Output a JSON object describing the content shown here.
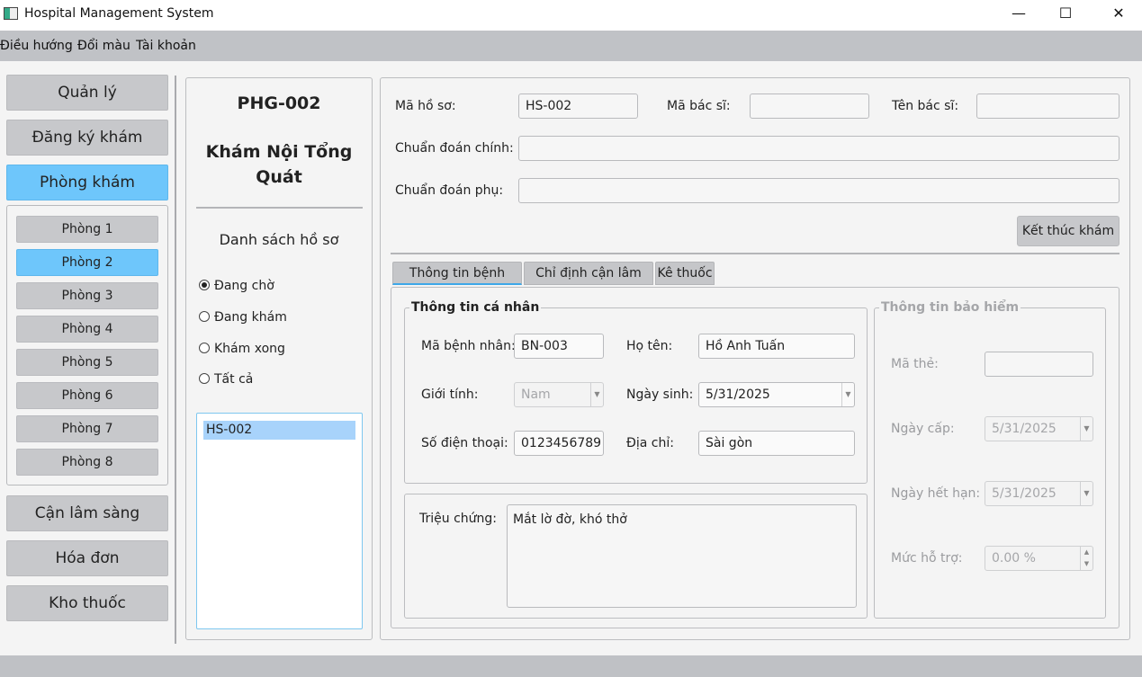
{
  "window": {
    "title": "Hospital Management System",
    "minimize": "—",
    "maximize": "☐",
    "close": "✕"
  },
  "menu": [
    "Điều hướng",
    "Đổi màu",
    "Tài khoản"
  ],
  "nav": {
    "top": [
      "Quản lý",
      "Đăng ký khám",
      "Phòng khám"
    ],
    "active": "Phòng khám",
    "rooms": [
      "Phòng 1",
      "Phòng 2",
      "Phòng 3",
      "Phòng 4",
      "Phòng 5",
      "Phòng 6",
      "Phòng 7",
      "Phòng 8"
    ],
    "active_room": "Phòng 2",
    "bottom": [
      "Cận lâm sàng",
      "Hóa đơn",
      "Kho thuốc"
    ]
  },
  "room": {
    "code": "PHG-002",
    "name": "Khám Nội Tổng Quát",
    "list_title": "Danh sách hồ sơ",
    "filters": [
      "Đang chờ",
      "Đang khám",
      "Khám xong",
      "Tất cả"
    ],
    "selected_filter": "Đang chờ",
    "records": [
      "HS-002"
    ]
  },
  "record": {
    "ma_ho_so_label": "Mã hồ sơ:",
    "ma_ho_so": "HS-002",
    "ma_bac_si_label": "Mã bác sĩ:",
    "ma_bac_si": "",
    "ten_bac_si_label": "Tên bác sĩ:",
    "ten_bac_si": "",
    "chan_doan_chinh_label": "Chuẩn đoán chính:",
    "chan_doan_chinh": "",
    "chan_doan_phu_label": "Chuẩn đoán phụ:",
    "chan_doan_phu": "",
    "finish_button": "Kết thúc khám"
  },
  "tabs": [
    "Thông tin bệnh nhân",
    "Chỉ định cận lâm sàn",
    "Kê thuốc"
  ],
  "active_tab": "Thông tin bệnh nhân",
  "personal": {
    "title": "Thông tin cá nhân",
    "ma_benh_nhan_label": "Mã bệnh nhân:",
    "ma_benh_nhan": "BN-003",
    "ho_ten_label": "Họ tên:",
    "ho_ten": "Hồ Anh Tuấn",
    "gioi_tinh_label": "Giới tính:",
    "gioi_tinh": "Nam",
    "ngay_sinh_label": "Ngày sinh:",
    "ngay_sinh": "5/31/2025",
    "sdt_label": "Số điện thoại:",
    "sdt": "0123456789",
    "dia_chi_label": "Địa chỉ:",
    "dia_chi": "Sài gòn"
  },
  "symptoms": {
    "label": "Triệu chứng:",
    "value": "Mắt lờ đờ, khó thở"
  },
  "insurance": {
    "title": "Thông tin bảo hiểm",
    "ma_the_label": "Mã thẻ:",
    "ma_the": "",
    "ngay_cap_label": "Ngày cấp:",
    "ngay_cap": "5/31/2025",
    "ngay_het_han_label": "Ngày hết hạn:",
    "ngay_het_han": "5/31/2025",
    "muc_ho_tro_label": "Mức hỗ trợ:",
    "muc_ho_tro": "0.00 %"
  }
}
